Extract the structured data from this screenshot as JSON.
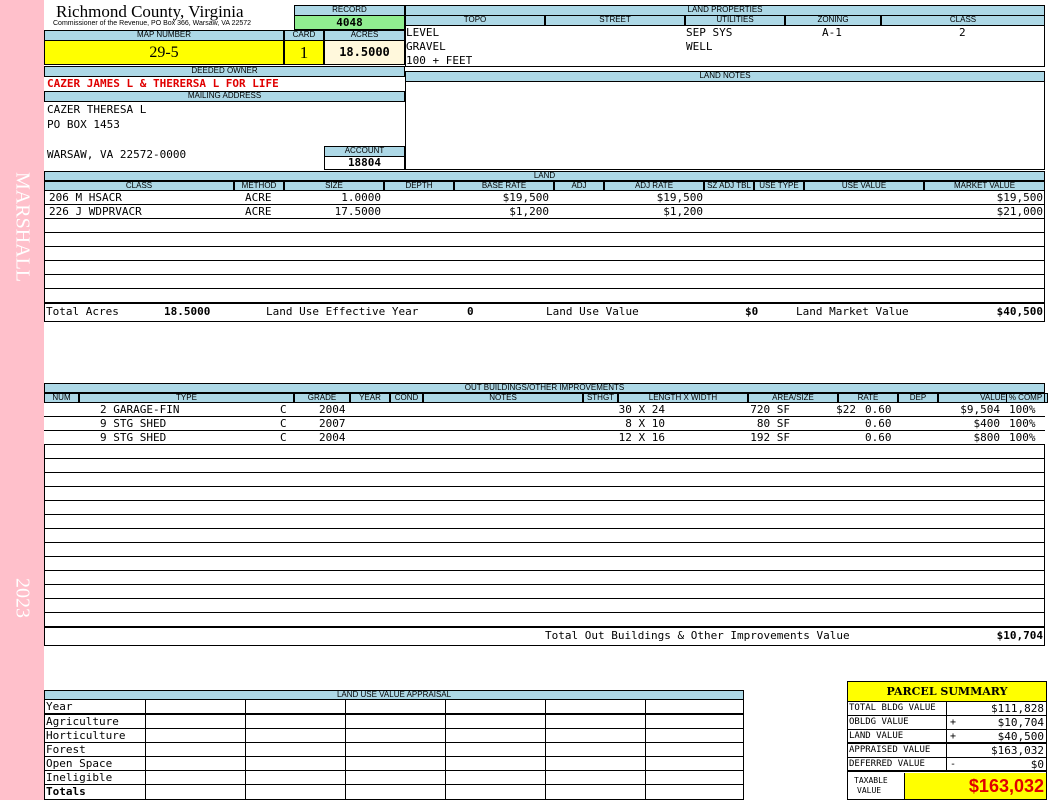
{
  "sidebar": {
    "owner_name": "MARSHALL",
    "year": "2023"
  },
  "header": {
    "county": "Richmond County, Virginia",
    "commissioner": "Commissioner of the Revenue, PO Box 366, Warsaw, VA 22572",
    "record_label": "RECORD",
    "record": "4048",
    "map_number_label": "MAP NUMBER",
    "map_number": "29-5",
    "card_label": "CARD",
    "card": "1",
    "acres_label": "ACRES",
    "acres": "18.5000"
  },
  "owner": {
    "deeded_owner_label": "DEEDED OWNER",
    "deeded_owner": "CAZER JAMES L & THERERSA L FOR LIFE",
    "mailing_label": "MAILING ADDRESS",
    "address1": "CAZER  THERESA L",
    "address2": "PO BOX 1453",
    "address3": "WARSAW, VA 22572-0000",
    "account_label": "ACCOUNT",
    "account": "18804"
  },
  "land_properties": {
    "title": "LAND PROPERTIES",
    "headers": [
      "TOPO",
      "STREET",
      "UTILITIES",
      "ZONING",
      "CLASS"
    ],
    "topo": [
      "LEVEL",
      "GRAVEL",
      "100 + FEET"
    ],
    "street": "",
    "utilities": [
      "SEP SYS",
      "WELL"
    ],
    "zoning": "A-1",
    "class": "2"
  },
  "land_notes": {
    "title": "LAND NOTES"
  },
  "land": {
    "title": "LAND",
    "headers": [
      "CLASS",
      "METHOD",
      "SIZE",
      "DEPTH",
      "BASE RATE",
      "ADJ",
      "ADJ RATE",
      "SZ ADJ TBL",
      "USE TYPE",
      "USE VALUE",
      "MARKET VALUE"
    ],
    "rows": [
      {
        "class": "206 M HSACR",
        "method": "ACRE",
        "size": "1.0000",
        "base_rate": "$19,500",
        "adj_rate": "$19,500",
        "market": "$19,500"
      },
      {
        "class": "226 J WDPRVACR",
        "method": "ACRE",
        "size": "17.5000",
        "base_rate": "$1,200",
        "adj_rate": "$1,200",
        "market": "$21,000"
      }
    ],
    "total_acres_label": "Total Acres",
    "total_acres": "18.5000",
    "eff_year_label": "Land Use Effective Year",
    "eff_year": "0",
    "use_value_label": "Land Use Value",
    "use_value": "$0",
    "market_label": "Land Market Value",
    "market_value": "$40,500"
  },
  "outbuildings": {
    "title": "OUT BUILDINGS/OTHER IMPROVEMENTS",
    "headers": [
      "NUM",
      "TYPE",
      "GRADE",
      "YEAR",
      "COND",
      "NOTES",
      "STHGT",
      "LENGTH X WIDTH",
      "AREA/SIZE",
      "RATE",
      "DEP",
      "VALUE",
      "% COMP"
    ],
    "rows": [
      {
        "type": "2 GARAGE-FIN",
        "grade": "C",
        "year": "2004",
        "lw": "30 X 24",
        "area": "720 SF",
        "rate": "$22",
        "dep": "0.60",
        "value": "$9,504",
        "comp": "100%"
      },
      {
        "type": "9 STG SHED",
        "grade": "C",
        "year": "2007",
        "lw": "8 X 10",
        "area": "80 SF",
        "rate": "",
        "dep": "0.60",
        "value": "$400",
        "comp": "100%"
      },
      {
        "type": "9 STG SHED",
        "grade": "C",
        "year": "2004",
        "lw": "12 X 16",
        "area": "192 SF",
        "rate": "",
        "dep": "0.60",
        "value": "$800",
        "comp": "100%"
      }
    ],
    "total_label": "Total Out Buildings & Other Improvements Value",
    "total": "$10,704"
  },
  "land_use": {
    "title": "LAND USE VALUE APPRAISAL",
    "rows": [
      "Year",
      "Agriculture",
      "Horticulture",
      "Forest",
      "Open Space",
      "Ineligible",
      "Totals"
    ]
  },
  "summary": {
    "title": "PARCEL SUMMARY",
    "rows": [
      {
        "label": "TOTAL BLDG VALUE",
        "sign": "",
        "value": "$111,828"
      },
      {
        "label": "OBLDG VALUE",
        "sign": "+",
        "value": "$10,704"
      },
      {
        "label": "LAND VALUE",
        "sign": "+",
        "value": "$40,500"
      },
      {
        "label": "APPRAISED VALUE",
        "sign": "",
        "value": "$163,032"
      },
      {
        "label": "DEFERRED VALUE",
        "sign": "-",
        "value": "$0"
      }
    ],
    "taxable_label1": "TAXABLE",
    "taxable_label2": "VALUE",
    "taxable": "$163,032"
  }
}
